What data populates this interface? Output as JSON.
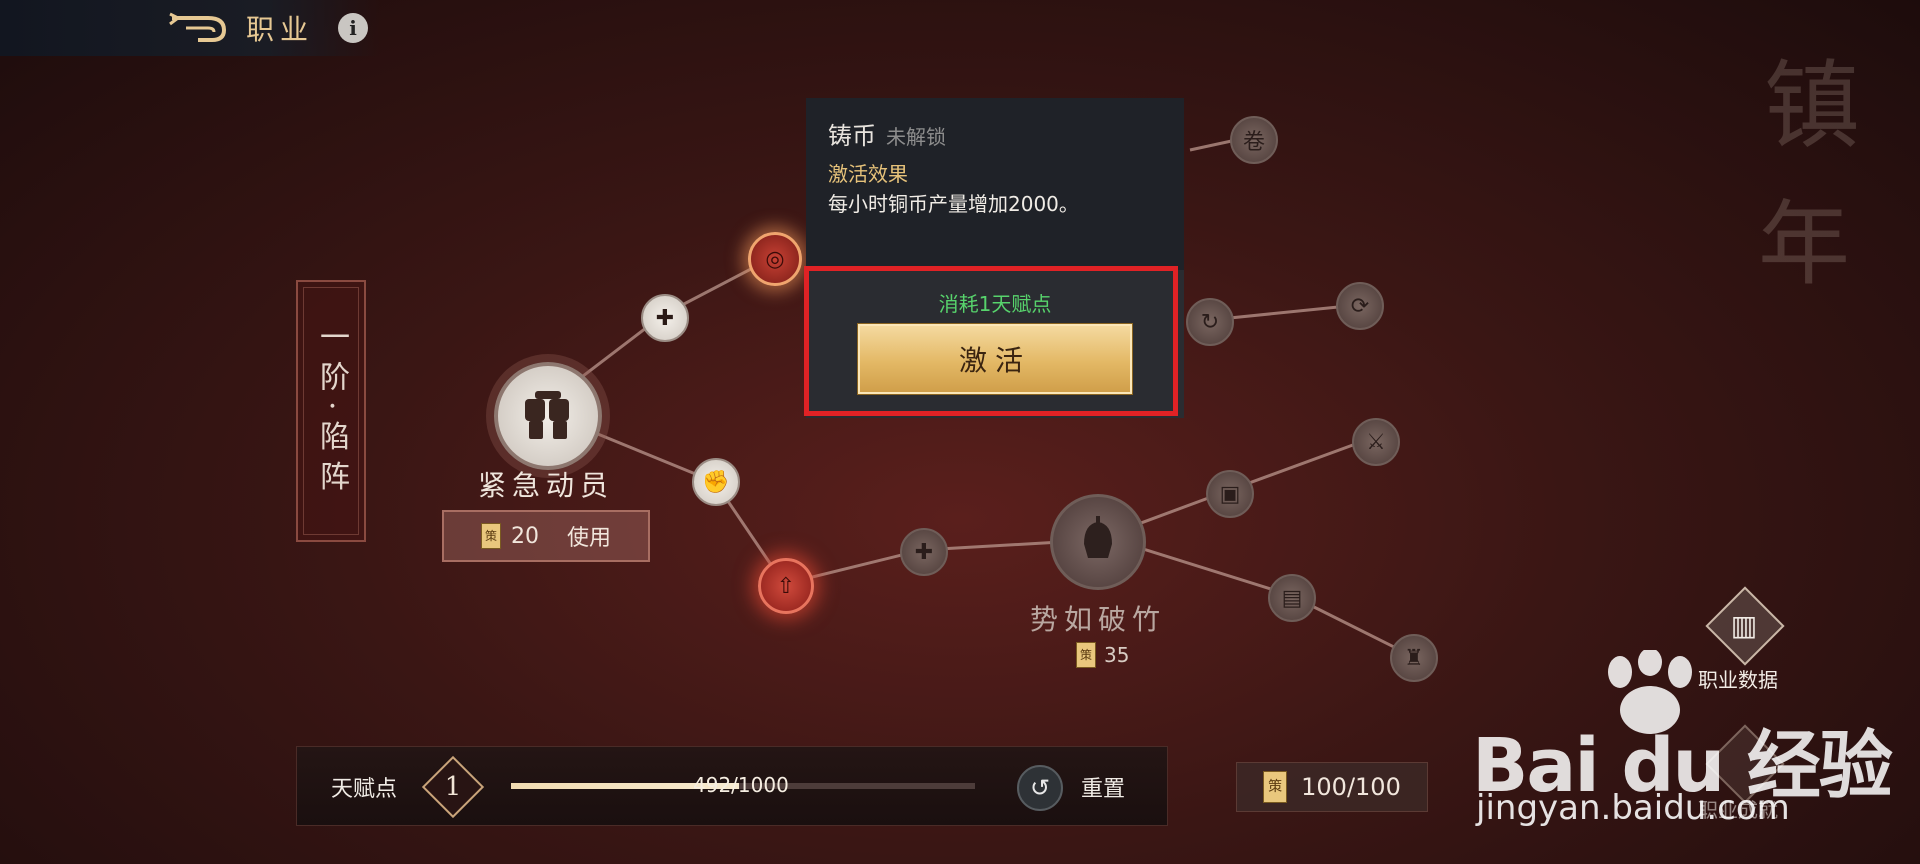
{
  "header": {
    "title": "职业",
    "back_icon": "back-arrow-icon",
    "info_glyph": "i"
  },
  "tier_panel": {
    "label": "一阶·陷阵"
  },
  "skill_tree": {
    "main_skill": {
      "name": "紧急动员",
      "cost": "20",
      "action_label": "使用",
      "icon": "raised-fists-icon"
    },
    "secondary_skill": {
      "name": "势如破竹",
      "cost": "35",
      "icon": "helmet-warrior-icon"
    },
    "cost_icon_glyph": "策"
  },
  "tooltip": {
    "name": "铸币",
    "status": "未解锁",
    "effect_title": "激活效果",
    "effect_desc": "每小时铜币产量增加2000。",
    "consume_text": "消耗1天赋点",
    "activate_label": "激活"
  },
  "decor": {
    "big_char_1": "镇",
    "big_char_2": "年"
  },
  "bottom": {
    "talent_label": "天赋点",
    "talent_points": "1",
    "progress_text": "492/1000",
    "progress_value": 492,
    "progress_max": 1000,
    "reset_label": "重置",
    "currency_glyph": "策",
    "currency_text": "100/100"
  },
  "sidebar": {
    "data_label": "职业数据",
    "second_label": "职业成就"
  },
  "watermark": {
    "brand": "Bai du 经验",
    "url": "jingyan.baidu.com"
  },
  "colors": {
    "accent_gold": "#e6c893",
    "highlight_red": "#e02225",
    "consume_green": "#57d36c"
  }
}
